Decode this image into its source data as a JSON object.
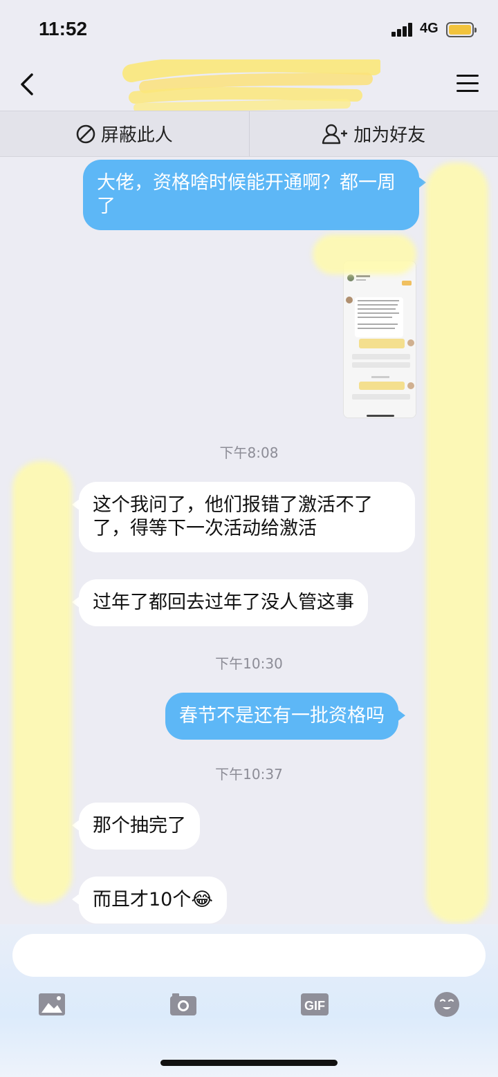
{
  "status_bar": {
    "time": "11:52",
    "network": "4G"
  },
  "nav": {
    "title": ""
  },
  "actions": {
    "block_label": "屏蔽此人",
    "add_friend_label": "加为好友"
  },
  "messages": [
    {
      "side": "me",
      "text": "大佬，资格啥时候能开通啊？都一周了"
    },
    {
      "side": "me",
      "type": "image"
    },
    {
      "type": "time",
      "text": "下午8:08"
    },
    {
      "side": "other",
      "text": "这个我问了，他们报错了激活不了了，得等下一次活动给激活"
    },
    {
      "side": "other",
      "text": "过年了都回去过年了没人管这事"
    },
    {
      "type": "time",
      "text": "下午10:30"
    },
    {
      "side": "me",
      "text": "春节不是还有一批资格吗"
    },
    {
      "type": "time",
      "text": "下午10:37"
    },
    {
      "side": "other",
      "text": "那个抽完了"
    },
    {
      "side": "other",
      "text": "而且才10个😂"
    }
  ],
  "input": {
    "value": ""
  },
  "toolbar": {
    "gif_label": "GIF"
  },
  "colors": {
    "my_bubble": "#5db7f6",
    "other_bubble": "#ffffff",
    "background": "#ececf3"
  }
}
